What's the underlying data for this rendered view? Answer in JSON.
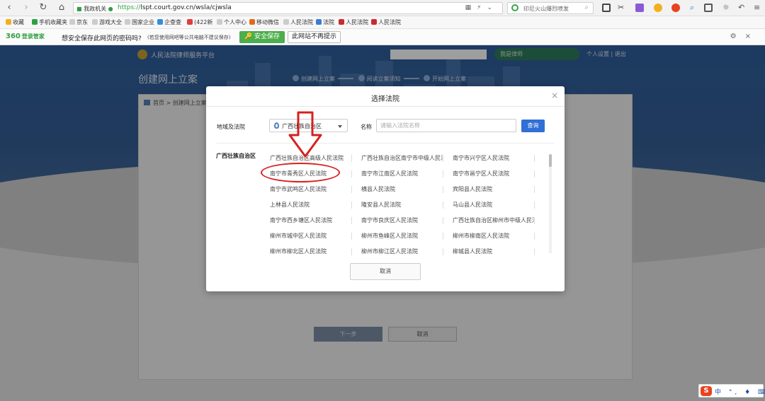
{
  "browser": {
    "secure_label": "我政机关",
    "url_proto": "https://",
    "url_rest": "lspt.court.gov.cn/wsla/cjwsla",
    "search_text": "印尼火山爆烈喷发"
  },
  "bookmarks": [
    {
      "label": "收藏",
      "color": "#f2b01e"
    },
    {
      "label": "手机收藏夹",
      "color": "#2ea043"
    },
    {
      "label": "京东",
      "color": "#cccccc"
    },
    {
      "label": "游戏大全",
      "color": "#cccccc"
    },
    {
      "label": "国家企业",
      "color": "#cccccc"
    },
    {
      "label": "企查查",
      "color": "#2f8fe0"
    },
    {
      "label": "(422新",
      "color": "#e33b3b"
    },
    {
      "label": "个人中心",
      "color": "#cccccc"
    },
    {
      "label": "移动微信",
      "color": "#e06b1f"
    },
    {
      "label": "人民法院",
      "color": "#cccccc"
    },
    {
      "label": "法院",
      "color": "#3b7bd6"
    },
    {
      "label": "人民法院",
      "color": "#cc2a2a"
    },
    {
      "label": "人民法院",
      "color": "#cc2a2a"
    }
  ],
  "password_bar": {
    "logo": "360",
    "logo_sub": "登录管家",
    "question": "想安全保存此网页的密码吗?",
    "note": "(若您使用网吧等公共电脑不建议保存)",
    "save_button": "安全保存",
    "no_button": "此网站不再提示"
  },
  "site": {
    "title": "人民法院律师服务平台",
    "role": "我是律师",
    "links": "个人设置  |  退出",
    "page_title": "创建网上立案",
    "steps": [
      "创建网上立案",
      "阅读立案须知",
      "开始网上立案"
    ],
    "breadcrumb": [
      "首页",
      "创建网上立案"
    ],
    "next_button": "下一步",
    "cancel_button": "取消"
  },
  "modal": {
    "title": "选择法院",
    "close": "×",
    "region_label": "地域及法院",
    "region_value": "广西壮族自治区",
    "name_label": "名称",
    "name_placeholder": "请输入法院名称",
    "query_button": "查询",
    "left_region": "广西壮族自治区",
    "courts": [
      "广西壮族自治区高级人民法院",
      "广西壮族自治区南宁市中级人民法院",
      "南宁市兴宁区人民法院",
      "南宁市青秀区人民法院",
      "南宁市江南区人民法院",
      "南宁市邕宁区人民法院",
      "南宁市武鸣区人民法院",
      "横县人民法院",
      "宾阳县人民法院",
      "上林县人民法院",
      "隆安县人民法院",
      "马山县人民法院",
      "南宁市西乡塘区人民法院",
      "南宁市良庆区人民法院",
      "广西壮族自治区柳州市中级人民法院",
      "柳州市城中区人民法院",
      "柳州市鱼峰区人民法院",
      "柳州市柳南区人民法院",
      "柳州市柳北区人民法院",
      "柳州市柳江区人民法院",
      "柳城县人民法院"
    ],
    "cancel_button": "取消"
  },
  "colors": {
    "accent_blue": "#2f6fd6",
    "annotation_red": "#d62020",
    "save_green": "#4cae4c"
  },
  "ime": {
    "logo": "S",
    "items": "中 °, ♦ ⌨ ☷"
  }
}
